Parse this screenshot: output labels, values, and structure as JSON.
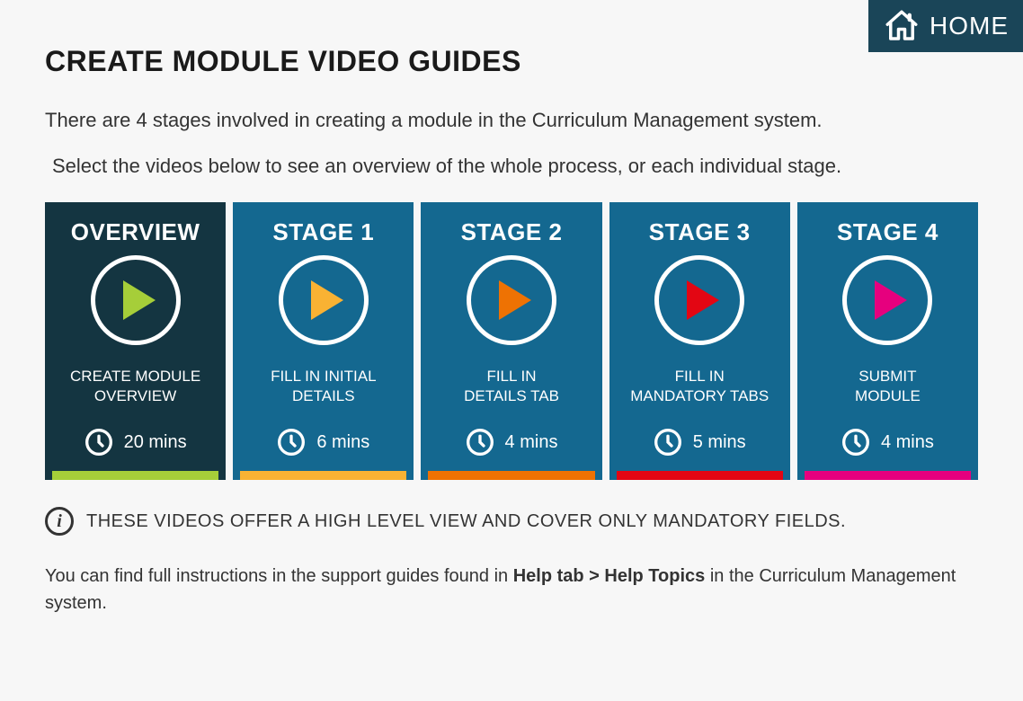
{
  "home_label": "HOME",
  "page_title": "CREATE MODULE VIDEO GUIDES",
  "intro_line1": "There are 4 stages involved in creating a module in the Curriculum Management system.",
  "intro_line2": "Select the videos below to see an overview of the whole process, or each individual stage.",
  "cards": [
    {
      "title": "OVERVIEW",
      "desc": "CREATE MODULE\nOVERVIEW",
      "duration": "20 mins",
      "accent": "#a6ce39",
      "play_color": "#a6ce39",
      "bg": "overview"
    },
    {
      "title": "STAGE 1",
      "desc": "FILL IN INITIAL\nDETAILS",
      "duration": "6 mins",
      "accent": "#f9b233",
      "play_color": "#f9b233",
      "bg": "stage"
    },
    {
      "title": "STAGE 2",
      "desc": "FILL IN\nDETAILS TAB",
      "duration": "4 mins",
      "accent": "#ee7203",
      "play_color": "#ee7203",
      "bg": "stage"
    },
    {
      "title": "STAGE 3",
      "desc": "FILL IN\nMANDATORY TABS",
      "duration": "5 mins",
      "accent": "#e30613",
      "play_color": "#e30613",
      "bg": "stage"
    },
    {
      "title": "STAGE 4",
      "desc": "SUBMIT\nMODULE",
      "duration": "4 mins",
      "accent": "#e6007e",
      "play_color": "#e6007e",
      "bg": "stage"
    }
  ],
  "info_text": "THESE VIDEOS OFFER A HIGH LEVEL VIEW AND COVER ONLY MANDATORY FIELDS.",
  "footer_prefix": "You can find full instructions in the support guides found in ",
  "footer_bold": "Help tab > Help Topics",
  "footer_suffix": " in the Curriculum Management system."
}
